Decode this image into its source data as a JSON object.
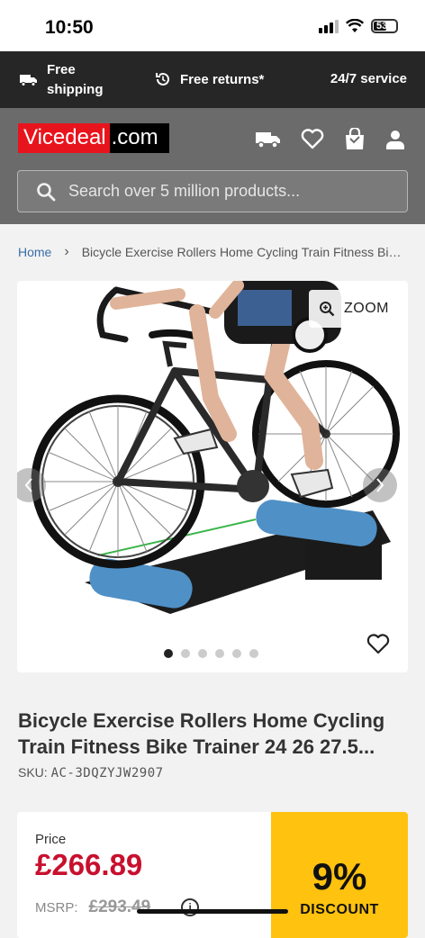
{
  "status": {
    "time": "10:50",
    "battery": "53"
  },
  "promo": {
    "shipping": "Free\nshipping",
    "returns": "Free returns*",
    "service": "24/7 service"
  },
  "header": {
    "logo_a": "Vicedeal",
    "logo_b": ".com",
    "search_placeholder": "Search over 5 million products..."
  },
  "breadcrumb": {
    "home": "Home",
    "current": "Bicycle Exercise Rollers Home Cycling Train Fitness Bike Trainer 24 26 27.5"
  },
  "gallery": {
    "zoom_label": "ZOOM",
    "dots": 6,
    "active_dot": 0
  },
  "product": {
    "title": "Bicycle Exercise Rollers Home Cycling Train Fitness Bike Trainer 24 26 27.5...",
    "sku_label": "SKU:",
    "sku": "AC-3DQZYJW2907"
  },
  "pricing": {
    "price_label": "Price",
    "price": "£266.89",
    "msrp_label": "MSRP:",
    "msrp": "£293.49",
    "discount_pct": "9%",
    "discount_label": "DISCOUNT"
  }
}
